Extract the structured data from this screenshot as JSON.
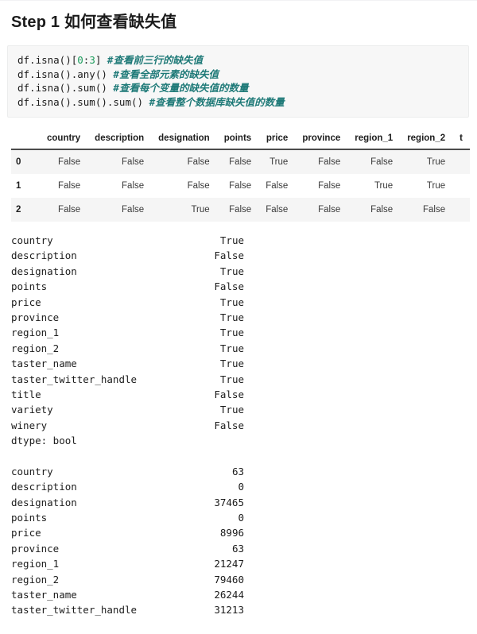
{
  "heading": {
    "text": "Step 1 如何查看缺失值"
  },
  "code_block": {
    "lines": [
      {
        "segments": [
          {
            "text": "df.isna()[",
            "type": "plain"
          },
          {
            "text": "0",
            "type": "number"
          },
          {
            "text": ":",
            "type": "plain"
          },
          {
            "text": "3",
            "type": "number"
          },
          {
            "text": "] ",
            "type": "plain"
          },
          {
            "text": "#查看前三行的缺失值",
            "type": "comment"
          }
        ]
      },
      {
        "segments": [
          {
            "text": "df.isna().any() ",
            "type": "plain"
          },
          {
            "text": "#查看全部元素的缺失值",
            "type": "comment"
          }
        ]
      },
      {
        "segments": [
          {
            "text": "df.isna().sum() ",
            "type": "plain"
          },
          {
            "text": "#查看每个变量的缺失值的数量",
            "type": "comment"
          }
        ]
      },
      {
        "segments": [
          {
            "text": "df.isna().sum().sum() ",
            "type": "plain"
          },
          {
            "text": "#查看整个数据库缺失值的数量",
            "type": "comment"
          }
        ]
      }
    ]
  },
  "dataframe": {
    "index_header": "",
    "columns": [
      "country",
      "description",
      "designation",
      "points",
      "price",
      "province",
      "region_1",
      "region_2",
      "t"
    ],
    "rows": [
      {
        "index": "0",
        "values": [
          "False",
          "False",
          "False",
          "False",
          "True",
          "False",
          "False",
          "True",
          ""
        ]
      },
      {
        "index": "1",
        "values": [
          "False",
          "False",
          "False",
          "False",
          "False",
          "False",
          "True",
          "True",
          ""
        ]
      },
      {
        "index": "2",
        "values": [
          "False",
          "False",
          "True",
          "False",
          "False",
          "False",
          "False",
          "False",
          ""
        ]
      }
    ]
  },
  "any_output": {
    "entries": [
      {
        "key": "country",
        "value": "True"
      },
      {
        "key": "description",
        "value": "False"
      },
      {
        "key": "designation",
        "value": "True"
      },
      {
        "key": "points",
        "value": "False"
      },
      {
        "key": "price",
        "value": "True"
      },
      {
        "key": "province",
        "value": "True"
      },
      {
        "key": "region_1",
        "value": "True"
      },
      {
        "key": "region_2",
        "value": "True"
      },
      {
        "key": "taster_name",
        "value": "True"
      },
      {
        "key": "taster_twitter_handle",
        "value": "True"
      },
      {
        "key": "title",
        "value": "False"
      },
      {
        "key": "variety",
        "value": "True"
      },
      {
        "key": "winery",
        "value": "False"
      }
    ],
    "dtype_line": "dtype: bool"
  },
  "sum_output": {
    "entries": [
      {
        "key": "country",
        "value": "63"
      },
      {
        "key": "description",
        "value": "0"
      },
      {
        "key": "designation",
        "value": "37465"
      },
      {
        "key": "points",
        "value": "0"
      },
      {
        "key": "price",
        "value": "8996"
      },
      {
        "key": "province",
        "value": "63"
      },
      {
        "key": "region_1",
        "value": "21247"
      },
      {
        "key": "region_2",
        "value": "79460"
      },
      {
        "key": "taster_name",
        "value": "26244"
      },
      {
        "key": "taster_twitter_handle",
        "value": "31213"
      }
    ]
  },
  "colors": {
    "code_background": "#f7f7f7",
    "comment": "#1f7a78",
    "number_literal": "#1a9c5b",
    "table_stripe": "#f5f5f5",
    "header_rule": "#4b4b4b"
  }
}
